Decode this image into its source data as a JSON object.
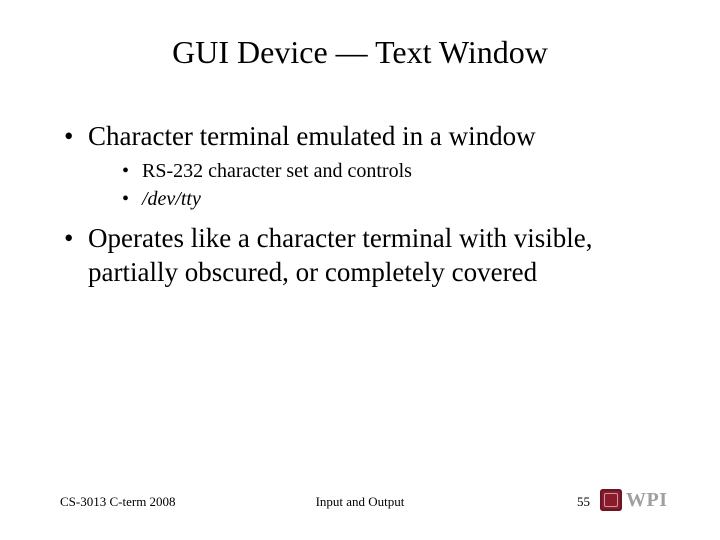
{
  "title": "GUI Device — Text Window",
  "bullets": {
    "b1": "Character terminal emulated in a window",
    "b1_subs": {
      "s1": "RS-232 character set and controls",
      "s2": "/dev/tty"
    },
    "b2": "Operates like a character terminal with visible, partially obscured, or completely covered"
  },
  "footer": {
    "left": "CS-3013 C-term 2008",
    "center": "Input and Output",
    "page": "55",
    "logo_text": "WPI"
  }
}
